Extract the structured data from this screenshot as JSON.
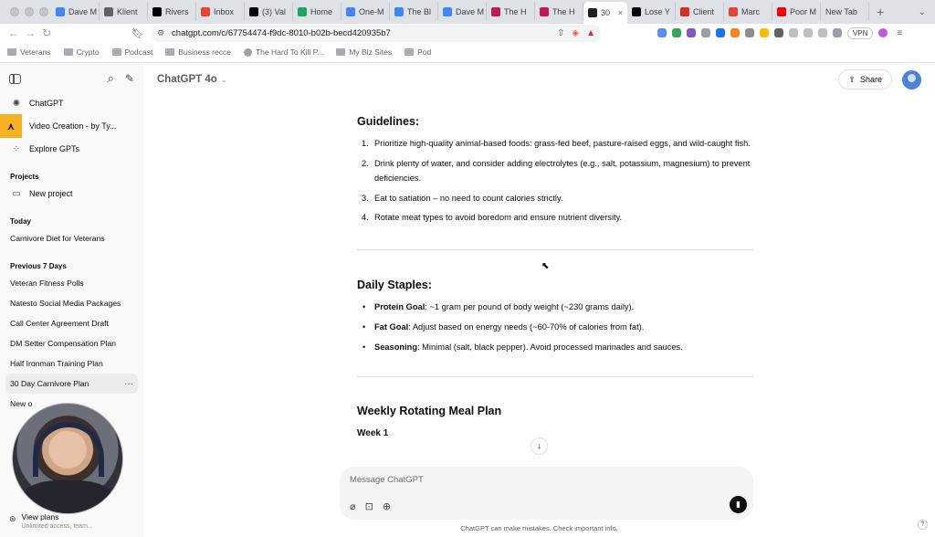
{
  "browser": {
    "tabs": [
      {
        "label": "Dave M",
        "icon": "docs-icon",
        "color": "#4285f4"
      },
      {
        "label": "Klient",
        "icon": "arrows-icon",
        "color": "#5f6368"
      },
      {
        "label": "Rivers",
        "icon": "x-icon",
        "color": "#000000"
      },
      {
        "label": "Inbox",
        "icon": "gmail-icon",
        "color": "#ea4335"
      },
      {
        "label": "(3) Val",
        "icon": "x-icon",
        "color": "#000000"
      },
      {
        "label": "Home",
        "icon": "drive-icon",
        "color": "#1fa463"
      },
      {
        "label": "One-M",
        "icon": "docs-icon",
        "color": "#4285f4"
      },
      {
        "label": "The Bl",
        "icon": "docs-icon",
        "color": "#4285f4"
      },
      {
        "label": "Dave M",
        "icon": "docs-icon",
        "color": "#4285f4"
      },
      {
        "label": "The H",
        "icon": "sk-icon",
        "color": "#c2185b"
      },
      {
        "label": "The H",
        "icon": "sk-icon",
        "color": "#c2185b"
      },
      {
        "label": "30",
        "icon": "chatgpt-icon",
        "color": "#202124",
        "active": true
      },
      {
        "label": "Lose Y",
        "icon": "notion-icon",
        "color": "#000000"
      },
      {
        "label": "Client",
        "icon": "loop-icon",
        "color": "#d93025"
      },
      {
        "label": "Marc",
        "icon": "m-icon",
        "color": "#ea4335"
      },
      {
        "label": "Poor M",
        "icon": "youtube-icon",
        "color": "#ff0000"
      },
      {
        "label": "New Tab",
        "icon": "",
        "color": ""
      }
    ],
    "new_tab_symbol": "+",
    "url": "chatgpt.com/c/67754474-f9dc-8010-b02b-becd420935b7",
    "vpn_label": "VPN",
    "bookmarks": [
      {
        "label": "Veterans",
        "type": "folder"
      },
      {
        "label": "Crypto",
        "type": "folder"
      },
      {
        "label": "Podcast",
        "type": "folder"
      },
      {
        "label": "Business recce",
        "type": "folder"
      },
      {
        "label": "The Hard To Kill P...",
        "type": "site"
      },
      {
        "label": "My Biz Sites",
        "type": "folder"
      },
      {
        "label": "Pod",
        "type": "folder"
      }
    ]
  },
  "sidebar": {
    "nav": [
      {
        "label": "ChatGPT",
        "icon": "chatgpt-logo-icon"
      },
      {
        "label": "Video Creation - by Ty...",
        "icon": "custom-gpt-icon"
      },
      {
        "label": "Explore GPTs",
        "icon": "grid-icon"
      }
    ],
    "projects_heading": "Projects",
    "new_project": "New project",
    "today_heading": "Today",
    "today_chats": [
      "Carnivore Diet for Veterans"
    ],
    "prev7_heading": "Previous 7 Days",
    "prev7_chats": [
      "Veteran Fitness Polls",
      "Natesto Social Media Packages",
      "Call Center Agreement Draft",
      "DM Setter Compensation Plan",
      "Half Ironman Training Plan",
      "30 Day Carnivore Plan",
      "New o"
    ],
    "selected_chat": "30 Day Carnivore Plan",
    "plans_title": "View plans",
    "plans_sub": "Unlimited access, team..."
  },
  "header": {
    "model": "ChatGPT 4o",
    "share_label": "Share"
  },
  "message": {
    "guidelines_heading": "Guidelines:",
    "guidelines": [
      {
        "num": "1.",
        "text": "Prioritize high-quality animal-based foods: grass-fed beef, pasture-raised eggs, and wild-caught fish."
      },
      {
        "num": "2.",
        "text": "Drink plenty of water, and consider adding electrolytes (e.g., salt, potassium, magnesium) to prevent deficiencies."
      },
      {
        "num": "3.",
        "text": "Eat to satiation – no need to count calories strictly."
      },
      {
        "num": "4.",
        "text": "Rotate meat types to avoid boredom and ensure nutrient diversity."
      }
    ],
    "staples_heading": "Daily Staples:",
    "staples": [
      {
        "label": "Protein Goal",
        "text": ": ~1 gram per pound of body weight (~230 grams daily)."
      },
      {
        "label": "Fat Goal",
        "text": ": Adjust based on energy needs (~60-70% of calories from fat)."
      },
      {
        "label": "Seasoning",
        "text": ": Minimal (salt, black pepper). Avoid processed marinades and sauces."
      }
    ],
    "meal_plan_heading": "Weekly Rotating Meal Plan",
    "week_label": "Week 1"
  },
  "composer": {
    "placeholder": "Message ChatGPT",
    "disclaimer": "ChatGPT can make mistakes. Check important info.",
    "help": "?"
  }
}
